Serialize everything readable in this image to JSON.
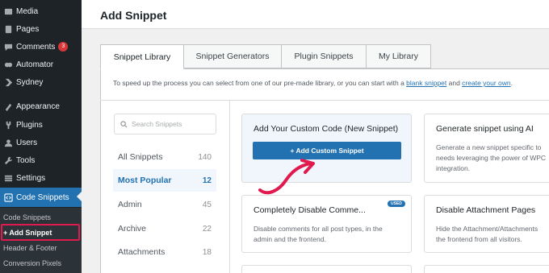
{
  "sidebar": {
    "items": [
      {
        "label": "Media",
        "icon": "media-icon"
      },
      {
        "label": "Pages",
        "icon": "pages-icon"
      },
      {
        "label": "Comments",
        "icon": "comments-icon",
        "badge": "3"
      },
      {
        "label": "Automator",
        "icon": "automator-icon"
      },
      {
        "label": "Sydney",
        "icon": "sydney-icon"
      },
      {
        "label": "Appearance",
        "icon": "appearance-icon"
      },
      {
        "label": "Plugins",
        "icon": "plugins-icon"
      },
      {
        "label": "Users",
        "icon": "users-icon"
      },
      {
        "label": "Tools",
        "icon": "tools-icon"
      },
      {
        "label": "Settings",
        "icon": "settings-icon"
      },
      {
        "label": "Code Snippets",
        "icon": "code-snippets-icon"
      }
    ],
    "submenu": [
      "Code Snippets",
      "+ Add Snippet",
      "Header & Footer",
      "Conversion Pixels"
    ]
  },
  "header": {
    "title": "Add Snippet"
  },
  "tabs": [
    "Snippet Library",
    "Snippet Generators",
    "Plugin Snippets",
    "My Library"
  ],
  "intro": {
    "text_before": "To speed up the process you can select from one of our pre-made library, or you can start with a ",
    "link1": "blank snippet",
    "text_mid": " and ",
    "link2": "create your own",
    "text_after": "."
  },
  "search": {
    "placeholder": "Search Snippets"
  },
  "categories": [
    {
      "name": "All Snippets",
      "count": "140"
    },
    {
      "name": "Most Popular",
      "count": "12"
    },
    {
      "name": "Admin",
      "count": "45"
    },
    {
      "name": "Archive",
      "count": "22"
    },
    {
      "name": "Attachments",
      "count": "18"
    }
  ],
  "cards": {
    "custom": {
      "title": "Add Your Custom Code (New Snippet)",
      "button": "+ Add Custom Snippet"
    },
    "ai": {
      "title": "Generate snippet using AI",
      "lines": [
        "Generate a new snippet specific to",
        "needs leveraging the power of WPC",
        "integration."
      ]
    },
    "comments": {
      "title": "Completely Disable Comme...",
      "badge": "USED",
      "lines": [
        "Disable comments for all post types, in the",
        "admin and the frontend."
      ]
    },
    "attachments": {
      "title": "Disable Attachment Pages",
      "lines": [
        "Hide the Attachment/Attachments",
        "the frontend from all visitors."
      ]
    }
  },
  "colors": {
    "accent": "#2271b1",
    "sidebar": "#1d2327",
    "highlight_box": "#e0194e",
    "annotation_arrow": "#e0194e"
  }
}
